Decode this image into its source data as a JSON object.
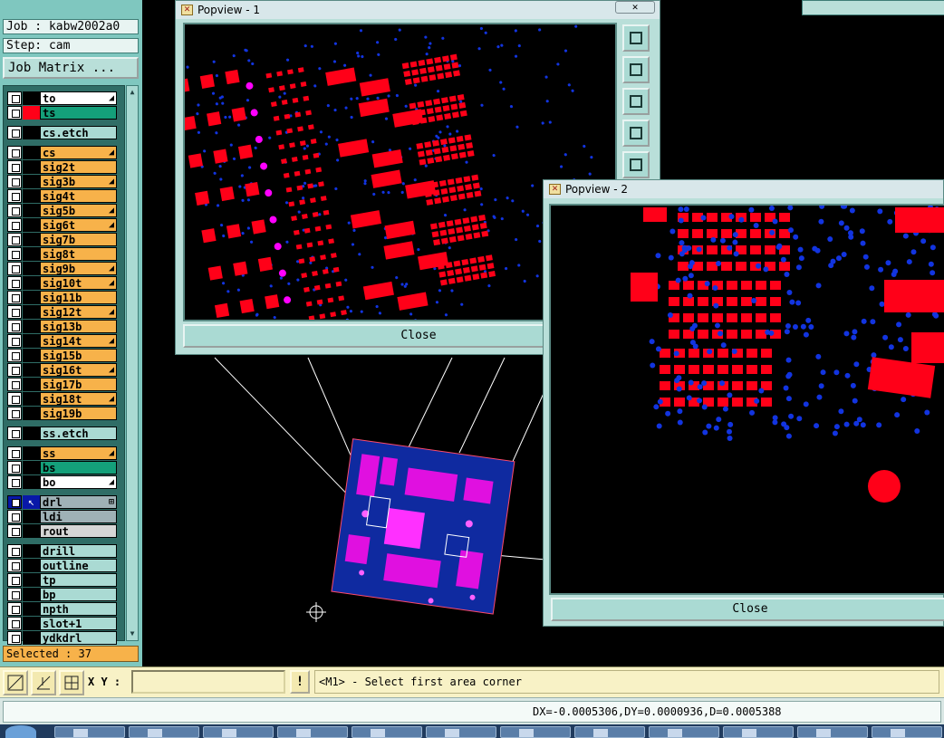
{
  "job": {
    "label": "Job : kabw2002a0",
    "step": "Step: cam",
    "matrix_button": "Job Matrix ..."
  },
  "colors": {
    "panel": "#7fc7bf",
    "signal": "#f7b24a",
    "solder_green": "#14a07a",
    "drill_grey": "#9fb1b6",
    "mech_teal": "#aadad3",
    "pad_red": "#ff0018",
    "via_blue": "#1234e0",
    "magenta": "#ff00ff",
    "message_bg": "#f8f2c6"
  },
  "layers": [
    {
      "name": "to",
      "color": "#ffffff",
      "swatch": "#000000",
      "marker": "◢"
    },
    {
      "name": "ts",
      "color": "#14a07a",
      "swatch": "#ff0018",
      "marker": ""
    },
    {
      "name": "cs.etch",
      "color": "#aadad3",
      "swatch": "#000000",
      "marker": ""
    },
    {
      "name": "cs",
      "color": "#f7b24a",
      "swatch": "#000000",
      "marker": "◢"
    },
    {
      "name": "sig2t",
      "color": "#f7b24a",
      "swatch": "#000000",
      "marker": ""
    },
    {
      "name": "sig3b",
      "color": "#f7b24a",
      "swatch": "#000000",
      "marker": "◢"
    },
    {
      "name": "sig4t",
      "color": "#f7b24a",
      "swatch": "#000000",
      "marker": ""
    },
    {
      "name": "sig5b",
      "color": "#f7b24a",
      "swatch": "#000000",
      "marker": "◢"
    },
    {
      "name": "sig6t",
      "color": "#f7b24a",
      "swatch": "#000000",
      "marker": "◢"
    },
    {
      "name": "sig7b",
      "color": "#f7b24a",
      "swatch": "#000000",
      "marker": ""
    },
    {
      "name": "sig8t",
      "color": "#f7b24a",
      "swatch": "#000000",
      "marker": ""
    },
    {
      "name": "sig9b",
      "color": "#f7b24a",
      "swatch": "#000000",
      "marker": "◢"
    },
    {
      "name": "sig10t",
      "color": "#f7b24a",
      "swatch": "#000000",
      "marker": "◢"
    },
    {
      "name": "sig11b",
      "color": "#f7b24a",
      "swatch": "#000000",
      "marker": ""
    },
    {
      "name": "sig12t",
      "color": "#f7b24a",
      "swatch": "#000000",
      "marker": "◢"
    },
    {
      "name": "sig13b",
      "color": "#f7b24a",
      "swatch": "#000000",
      "marker": ""
    },
    {
      "name": "sig14t",
      "color": "#f7b24a",
      "swatch": "#000000",
      "marker": "◢"
    },
    {
      "name": "sig15b",
      "color": "#f7b24a",
      "swatch": "#000000",
      "marker": ""
    },
    {
      "name": "sig16t",
      "color": "#f7b24a",
      "swatch": "#000000",
      "marker": "◢"
    },
    {
      "name": "sig17b",
      "color": "#f7b24a",
      "swatch": "#000000",
      "marker": ""
    },
    {
      "name": "sig18t",
      "color": "#f7b24a",
      "swatch": "#000000",
      "marker": "◢"
    },
    {
      "name": "sig19b",
      "color": "#f7b24a",
      "swatch": "#000000",
      "marker": ""
    },
    {
      "name": "ss.etch",
      "color": "#aadad3",
      "swatch": "#000000",
      "marker": ""
    },
    {
      "name": "ss",
      "color": "#f7b24a",
      "swatch": "#000000",
      "marker": "◢"
    },
    {
      "name": "bs",
      "color": "#14a07a",
      "swatch": "#000000",
      "marker": ""
    },
    {
      "name": "bo",
      "color": "#ffffff",
      "swatch": "#000000",
      "marker": "◢"
    },
    {
      "name": "drl",
      "color": "#9fb1b6",
      "swatch": "#0818a8",
      "marker": "⊞",
      "active": true
    },
    {
      "name": "ldi",
      "color": "#9fb1b6",
      "swatch": "#000000",
      "marker": ""
    },
    {
      "name": "rout",
      "color": "#d6d6d6",
      "swatch": "#000000",
      "marker": ""
    },
    {
      "name": "drill",
      "color": "#aadad3",
      "swatch": "#000000",
      "marker": ""
    },
    {
      "name": "outline",
      "color": "#aadad3",
      "swatch": "#000000",
      "marker": ""
    },
    {
      "name": "tp",
      "color": "#aadad3",
      "swatch": "#000000",
      "marker": ""
    },
    {
      "name": "bp",
      "color": "#aadad3",
      "swatch": "#000000",
      "marker": ""
    },
    {
      "name": "npth",
      "color": "#aadad3",
      "swatch": "#000000",
      "marker": ""
    },
    {
      "name": "slot+1",
      "color": "#aadad3",
      "swatch": "#000000",
      "marker": ""
    },
    {
      "name": "ydkdrl",
      "color": "#aadad3",
      "swatch": "#000000",
      "marker": ""
    }
  ],
  "selected": "Selected : 37",
  "popview1": {
    "title": "Popview - 1",
    "close_label": "Close",
    "tools": [
      "zoom-icon",
      "move-up-icon",
      "move-down-icon",
      "move-left-icon",
      "move-right-icon"
    ]
  },
  "popview2": {
    "title": "Popview - 2",
    "close_label": "Close"
  },
  "command": {
    "xy_label": "X Y :",
    "xy_value": "",
    "bang_label": "!",
    "message": "<M1> - Select first area corner"
  },
  "status": "DX=-0.0005306,DY=0.0000936,D=0.0005388"
}
